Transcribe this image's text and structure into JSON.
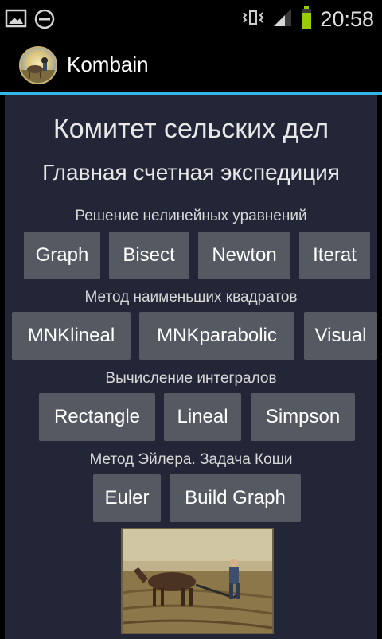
{
  "status_bar": {
    "time": "20:58",
    "icons": [
      "image-icon",
      "dnd-icon",
      "vibrate-icon",
      "signal-icon",
      "battery-icon"
    ]
  },
  "action_bar": {
    "title": "Kombain",
    "accent_color": "#33b5e5"
  },
  "main": {
    "title": "Комитет сельских дел",
    "subtitle": "Главная счетная экспедиция",
    "sections": [
      {
        "label": "Решение нелинейных уравнений",
        "buttons": [
          "Graph",
          "Bisect",
          "Newton",
          "Iterat"
        ]
      },
      {
        "label": "Метод наименьших квадратов",
        "buttons": [
          "MNKlineal",
          "MNKparabolic",
          "Visual"
        ]
      },
      {
        "label": "Вычисление интегралов",
        "buttons": [
          "Rectangle",
          "Lineal",
          "Simpson"
        ]
      },
      {
        "label": "Метод Эйлера. Задача Коши",
        "buttons": [
          "Euler",
          "Build Graph"
        ]
      }
    ]
  }
}
